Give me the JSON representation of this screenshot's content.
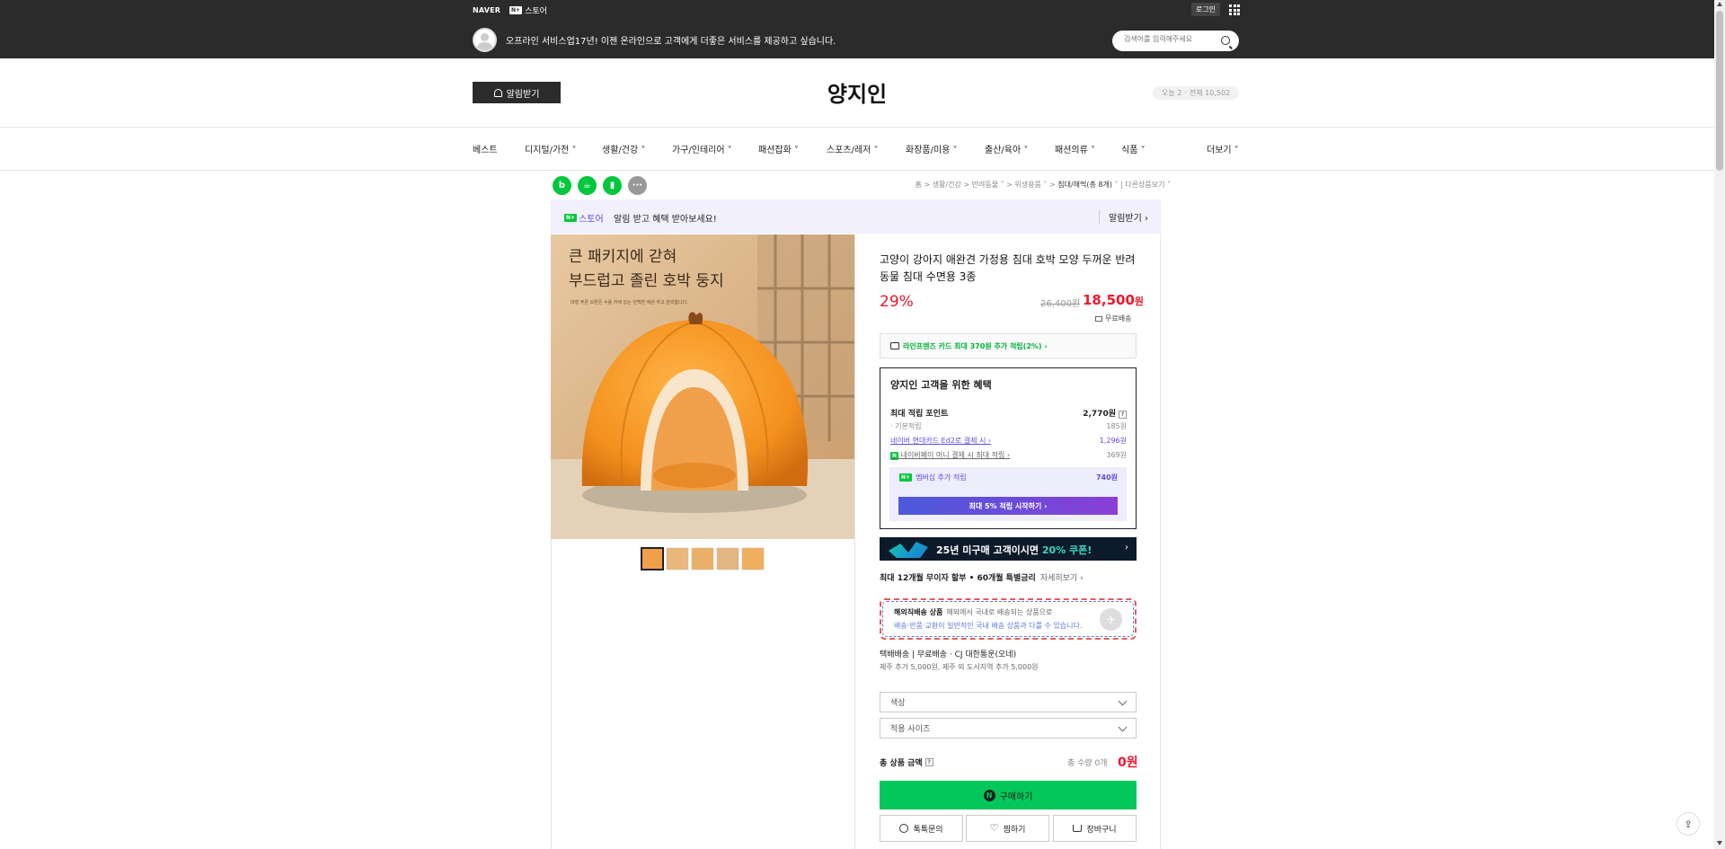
{
  "topbar": {
    "naver": "NAVER",
    "npay": "N+",
    "store_label": "스토어",
    "login": "로그인",
    "store_desc": "오프라인 서비스업17년! 이젠 온라인으로 고객에게 더좋은 서비스를 제공하고 싶습니다.",
    "search_placeholder": "검색어를 입력해주세요"
  },
  "header": {
    "alarm_button": "알림받기",
    "store_name": "양지인",
    "visit_today": "오늘 2",
    "visit_sep": "·",
    "visit_total": "전체 10,502"
  },
  "nav": {
    "items": [
      "베스트",
      "디지털/가전",
      "생활/건강",
      "가구/인테리어",
      "패션잡화",
      "스포츠/레저",
      "화장품/미용",
      "출산/육아",
      "패션의류",
      "식품"
    ],
    "more": "더보기"
  },
  "breadcrumb": {
    "items": [
      "홈",
      "생활/건강",
      "반려동물",
      "위생용품",
      "침대/해먹(총 8개)"
    ],
    "other": "다른상품보기"
  },
  "promo": {
    "logo_text": "스토어",
    "badge": "N+",
    "text": "알림 받고 혜택 받아보세요!",
    "right": "알림받기"
  },
  "product_image": {
    "headline_1": "큰 패키지에 갇혀",
    "headline_2": "부드럽고 졸린 호박 둥지",
    "subtext": "대형 푸른 보폰은 수용 하에 있는 단백한 애완 하고 관리합니다."
  },
  "product": {
    "title": "고양이 강아지 애완견 가정용 침대 호박 모양 두꺼운 반려동물 침대 수면용 3종",
    "discount": "29%",
    "original_price": "26,400원",
    "sale_price": "18,500",
    "won": "원",
    "shipping": "무료배송",
    "card_benefit": "라인프렌즈 카드 최대 370원 추가 적립(2%) ›"
  },
  "benefit": {
    "title": "양지인 고객을 위한 혜택",
    "max_points_label": "최대 적립 포인트",
    "max_points_value": "2,770원",
    "help": "?",
    "rows": [
      {
        "label": "기본적립",
        "value": "185원"
      },
      {
        "label": "네이버 현대카드 Ed2로 결제 시 ›",
        "value": "1,296원"
      },
      {
        "label": "네이버페이 머니 결제 시 최대 적립 ›",
        "value": "369원"
      }
    ],
    "member_label": "멤버십 추가 적립",
    "member_value": "740원",
    "member_button": "최대 5% 적립 시작하기 ›"
  },
  "coupon": {
    "text_1": "25년 미구매 고객이시면 ",
    "text_2": "20% 쿠폰!",
    "arrow": "›"
  },
  "installment": {
    "main": "최대 12개월 무이자 할부 • 60개월 특별금리",
    "detail": "자세히보기 ›"
  },
  "overseas": {
    "title": "해외직배송 상품",
    "title_sub": "해외에서 국내로 배송되는 상품으로",
    "sub": "배송·반품·교환이 일반적인 국내 배송 상품과 다를 수 있습니다."
  },
  "delivery": {
    "line_1": "택배배송  |  무료배송 · CJ 대한통운(오네)",
    "line_2": "제주 추가 5,000원, 제주 외 도서지역 추가 5,000원"
  },
  "options": {
    "color": "색상",
    "size": "적용 사이즈"
  },
  "total": {
    "label": "총 상품 금액",
    "qty": "총 수량 0개",
    "price": "0원"
  },
  "actions": {
    "buy": "구매하기",
    "talk": "톡톡문의",
    "wish": "찜하기",
    "cart": "장바구니"
  },
  "colors": {
    "accent_red": "#f5142d",
    "naver_green": "#03c75a",
    "purple": "#5b4ee3"
  }
}
